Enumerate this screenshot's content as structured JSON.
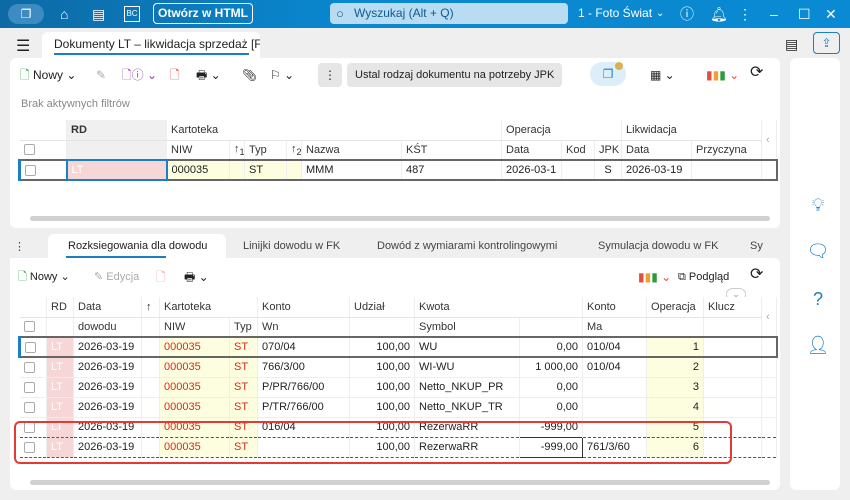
{
  "titlebar": {
    "open_html": "Otwórz w HTML",
    "search_placeholder": "Wyszukaj (Alt + Q)",
    "company": "1 - Foto Świat"
  },
  "doc_tab": "Dokumenty LT – likwidacja sprzedaż [F",
  "top_toolbar": {
    "new": "Nowy",
    "jpk_button": "Ustal rodzaj dokumentu na potrzeby JPK",
    "filters": "Brak aktywnych filtrów"
  },
  "top_grid": {
    "groups": [
      "RD",
      "Kartoteka",
      "Operacja",
      "Likwidacja"
    ],
    "columns": [
      "NIW",
      "Typ",
      "Nazwa",
      "KŚT",
      "Data",
      "Kod",
      "JPK",
      "Data",
      "Przyczyna"
    ],
    "sort": [
      "1",
      "2"
    ],
    "row": {
      "rd": "LT",
      "niw": "000035",
      "typ": "ST",
      "nazwa": "MMM",
      "kst": "487",
      "op_data": "2026-03-1",
      "kod": "",
      "jpk": "S",
      "lik_data": "2026-03-19",
      "przyczyna": ""
    }
  },
  "tabs": [
    "Rozksiegowania dla dowodu",
    "Linijki dowodu w FK",
    "Dowód z wymiarami kontrolingowymi",
    "Symulacja dowodu w FK",
    "Sy"
  ],
  "bottom_toolbar": {
    "new": "Nowy",
    "edit": "Edycja",
    "preview": "Podgląd"
  },
  "bottom_grid": {
    "headers1": [
      "RD",
      "Data",
      "Kartoteka",
      "Konto",
      "Udział",
      "Kwota",
      "Konto",
      "Operacja",
      "Klucz"
    ],
    "headers2": [
      "dowodu",
      "NIW",
      "Typ",
      "Wn",
      "Symbol",
      "Ma"
    ],
    "rows": [
      {
        "rd": "LT",
        "data": "2026-03-19",
        "niw": "000035",
        "typ": "ST",
        "wn": "070/04",
        "udzial": "100,00",
        "symbol": "WU",
        "kwota": "0,00",
        "ma": "010/04",
        "op": "1"
      },
      {
        "rd": "LT",
        "data": "2026-03-19",
        "niw": "000035",
        "typ": "ST",
        "wn": "766/3/00",
        "udzial": "100,00",
        "symbol": "WI-WU",
        "kwota": "1 000,00",
        "ma": "010/04",
        "op": "2"
      },
      {
        "rd": "LT",
        "data": "2026-03-19",
        "niw": "000035",
        "typ": "ST",
        "wn": "P/PR/766/00",
        "udzial": "100,00",
        "symbol": "Netto_NKUP_PR",
        "kwota": "0,00",
        "ma": "",
        "op": "3"
      },
      {
        "rd": "LT",
        "data": "2026-03-19",
        "niw": "000035",
        "typ": "ST",
        "wn": "P/TR/766/00",
        "udzial": "100,00",
        "symbol": "Netto_NKUP_TR",
        "kwota": "0,00",
        "ma": "",
        "op": "4"
      },
      {
        "rd": "LT",
        "data": "2026-03-19",
        "niw": "000035",
        "typ": "ST",
        "wn": "016/04",
        "udzial": "100,00",
        "symbol": "RezerwaRR",
        "kwota": "-999,00",
        "ma": "",
        "op": "5"
      },
      {
        "rd": "LT",
        "data": "2026-03-19",
        "niw": "000035",
        "typ": "ST",
        "wn": "",
        "udzial": "100,00",
        "symbol": "RezerwaRR",
        "kwota": "-999,00",
        "ma": "761/3/60",
        "op": "6"
      }
    ]
  },
  "colors": {
    "titlebar": "#0a87cf",
    "highlight": "#e53935",
    "accent": "#1a7fc4"
  }
}
